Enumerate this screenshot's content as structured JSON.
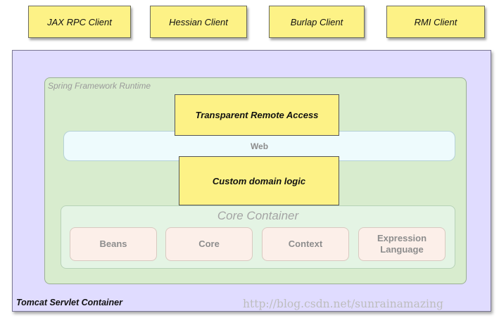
{
  "clients": [
    {
      "label": "JAX RPC Client"
    },
    {
      "label": "Hessian Client"
    },
    {
      "label": "Burlap Client"
    },
    {
      "label": "RMI Client"
    }
  ],
  "tomcat": {
    "label": "Tomcat Servlet Container"
  },
  "spring": {
    "label": "Spring Framework Runtime"
  },
  "remote_access": {
    "label": "Transparent Remote Access"
  },
  "web": {
    "label": "Web"
  },
  "domain_logic": {
    "label": "Custom domain logic"
  },
  "core_container": {
    "title": "Core Container",
    "modules": [
      {
        "label": "Beans"
      },
      {
        "label": "Core"
      },
      {
        "label": "Context"
      },
      {
        "label": "Expression\nLanguage"
      }
    ]
  },
  "watermark": "http://blog.csdn.net/sunrainamazing",
  "colors": {
    "client_fill": "#fdf286",
    "tomcat_fill": "#e0dcff",
    "spring_fill": "#d8ecce",
    "web_fill": "#eefbfd",
    "core_fill": "#e4f4e4",
    "module_fill": "#fcefe9"
  }
}
